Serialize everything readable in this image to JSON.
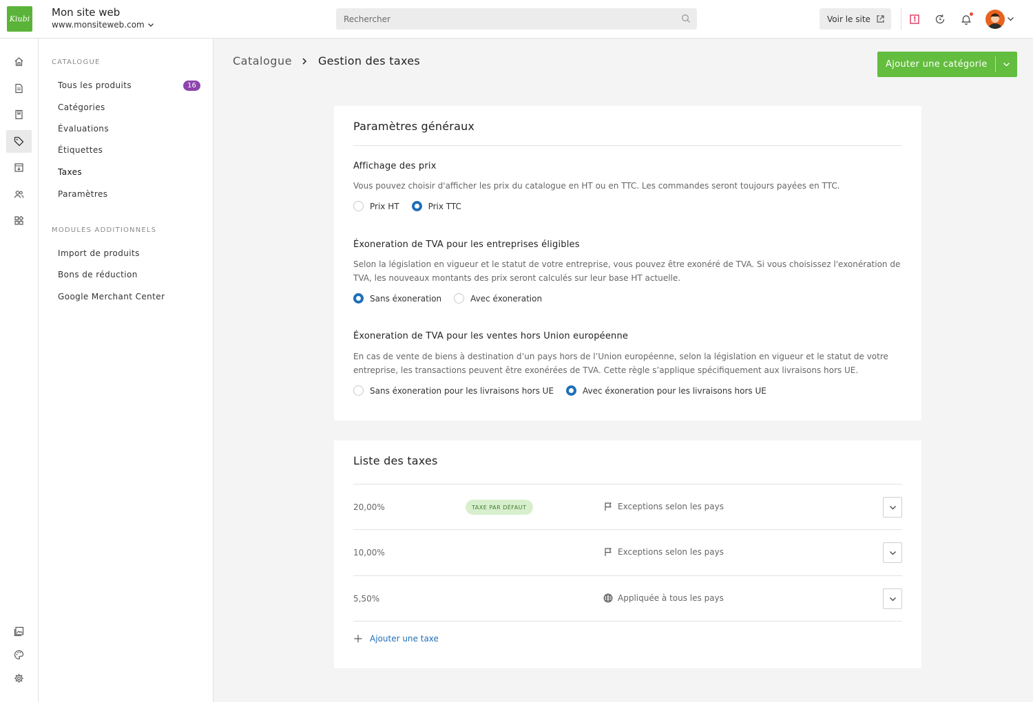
{
  "header": {
    "logo_text": "Kiubi",
    "site_name": "Mon site web",
    "site_url": "www.monsiteweb.com",
    "search_placeholder": "Rechercher",
    "view_site_label": "Voir le site"
  },
  "sidebar": {
    "catalogue_heading": "CATALOGUE",
    "catalogue_items": [
      {
        "label": "Tous les produits",
        "count": "16"
      },
      {
        "label": "Catégories"
      },
      {
        "label": "Évaluations"
      },
      {
        "label": "Étiquettes"
      },
      {
        "label": "Taxes"
      },
      {
        "label": "Paramètres"
      }
    ],
    "modules_heading": "MODULES ADDITIONNELS",
    "module_items": [
      {
        "label": "Import de produits"
      },
      {
        "label": "Bons de réduction"
      },
      {
        "label": "Google Merchant Center"
      }
    ]
  },
  "page": {
    "breadcrumb_root": "Catalogue",
    "breadcrumb_current": "Gestion des taxes",
    "add_category_label": "Ajouter une catégorie"
  },
  "general": {
    "title": "Paramètres généraux",
    "price_display": {
      "title": "Affichage des prix",
      "description": "Vous pouvez choisir d'afficher les prix du catalogue en HT ou en TTC. Les commandes seront toujours payées en TTC.",
      "options": [
        "Prix HT",
        "Prix TTC"
      ],
      "selected": "Prix TTC"
    },
    "vat_exemption": {
      "title": "Éxoneration de TVA pour les entreprises éligibles",
      "description": "Selon la législation en vigueur et le statut de votre entreprise, vous pouvez être exonéré de TVA. Si vous choisissez l'exonération de TVA, les nouveaux montants des prix seront calculés sur leur base HT actuelle.",
      "options": [
        "Sans éxoneration",
        "Avec éxoneration"
      ],
      "selected": "Sans éxoneration"
    },
    "non_eu_exemption": {
      "title": "Éxoneration de TVA pour les ventes hors Union européenne",
      "description": "En cas de vente de biens à destination d’un pays hors de l’Union européenne, selon la législation en vigueur et le statut de votre entreprise, les transactions peuvent être exonérées de TVA. Cette règle s’applique spécifiquement aux livraisons hors UE.",
      "options": [
        "Sans éxoneration pour les livraisons hors UE",
        "Avec éxoneration pour les livraisons hors UE"
      ],
      "selected": "Avec éxoneration pour les livraisons hors UE"
    }
  },
  "taxes": {
    "title": "Liste des taxes",
    "rows": [
      {
        "rate": "20,00%",
        "badge": "TAXE PAR DÉFAUT",
        "scope": "Exceptions selon les pays",
        "scope_icon": "flag-icon"
      },
      {
        "rate": "10,00%",
        "badge": "",
        "scope": "Exceptions selon les pays",
        "scope_icon": "flag-icon"
      },
      {
        "rate": "5,50%",
        "badge": "",
        "scope": "Appliquée à tous les pays",
        "scope_icon": "globe-icon"
      }
    ],
    "add_label": "Ajouter une taxe"
  },
  "colors": {
    "brand_green": "#63bd3e",
    "radio_blue": "#1e6fb8",
    "count_badge": "#8e44ad",
    "default_badge_bg": "#d8efce",
    "notification_dot": "#e74c3c"
  }
}
